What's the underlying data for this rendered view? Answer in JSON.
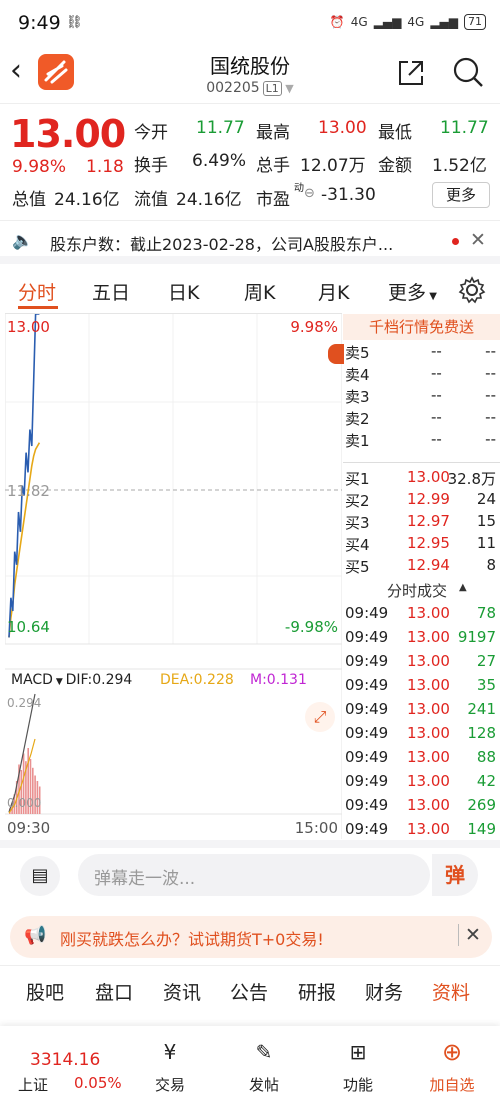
{
  "status": {
    "time": "9:49",
    "net1": "4G",
    "net2": "4G",
    "battery": "71"
  },
  "header": {
    "title": "国统股份",
    "code": "002205",
    "level": "L1"
  },
  "quote": {
    "price": "13.00",
    "change_pct": "9.98%",
    "change": "1.18",
    "open_label": "今开",
    "open": "11.77",
    "high_label": "最高",
    "high": "13.00",
    "low_label": "最低",
    "low": "11.77",
    "turnover_label": "换手",
    "turnover": "6.49%",
    "volume_label": "总手",
    "volume": "12.07万",
    "amount_label": "金额",
    "amount": "1.52亿",
    "total_cap_label": "总值",
    "total_cap": "24.16亿",
    "float_cap_label": "流值",
    "float_cap": "24.16亿",
    "pe_label": "市盈",
    "pe_sup": "动",
    "pe": "-31.30",
    "more": "更多"
  },
  "notice": {
    "text": "股东户数：截止2023-02-28，公司A股股东户..."
  },
  "tabs": [
    "分时",
    "五日",
    "日K",
    "周K",
    "月K",
    "更多"
  ],
  "chart": {
    "top_price": "13.00",
    "top_pct": "9.98%",
    "mid_price": "11.82",
    "bottom_price": "10.64",
    "bottom_pct": "-9.98%",
    "macd_label": "MACD",
    "dif": "DIF:0.294",
    "dea": "DEA:0.228",
    "m": "M:0.131",
    "macd_top": "0.294",
    "macd_zero": "0.000",
    "time_start": "09:30",
    "time_end": "15:00",
    "price_line": [
      0.98,
      0.86,
      0.9,
      0.72,
      0.76,
      0.6,
      0.66,
      0.52,
      0.55,
      0.42,
      0.48,
      0.35,
      0.4,
      0.2,
      0.0,
      0.0,
      0.0
    ],
    "avg_line": [
      0.98,
      0.92,
      0.88,
      0.82,
      0.78,
      0.74,
      0.7,
      0.66,
      0.62,
      0.58,
      0.54,
      0.5,
      0.46,
      0.43,
      0.41,
      0.4,
      0.39
    ],
    "macd_bars": [
      0.05,
      0.1,
      0.18,
      0.3,
      0.45,
      0.4,
      0.55,
      0.48,
      0.6,
      0.5,
      0.42,
      0.35,
      0.3,
      0.25
    ]
  },
  "orderbook": {
    "promo": "千档行情免费送",
    "asks": [
      {
        "label": "卖5",
        "price": "--",
        "vol": "--"
      },
      {
        "label": "卖4",
        "price": "--",
        "vol": "--"
      },
      {
        "label": "卖3",
        "price": "--",
        "vol": "--"
      },
      {
        "label": "卖2",
        "price": "--",
        "vol": "--"
      },
      {
        "label": "卖1",
        "price": "--",
        "vol": "--"
      }
    ],
    "bids": [
      {
        "label": "买1",
        "price": "13.00",
        "vol": "32.8万"
      },
      {
        "label": "买2",
        "price": "12.99",
        "vol": "24"
      },
      {
        "label": "买3",
        "price": "12.97",
        "vol": "15"
      },
      {
        "label": "买4",
        "price": "12.95",
        "vol": "11"
      },
      {
        "label": "买5",
        "price": "12.94",
        "vol": "8"
      }
    ],
    "trades_title": "分时成交",
    "trades": [
      {
        "time": "09:49",
        "price": "13.00",
        "vol": "78"
      },
      {
        "time": "09:49",
        "price": "13.00",
        "vol": "9197"
      },
      {
        "time": "09:49",
        "price": "13.00",
        "vol": "27"
      },
      {
        "time": "09:49",
        "price": "13.00",
        "vol": "35"
      },
      {
        "time": "09:49",
        "price": "13.00",
        "vol": "241"
      },
      {
        "time": "09:49",
        "price": "13.00",
        "vol": "128"
      },
      {
        "time": "09:49",
        "price": "13.00",
        "vol": "88"
      },
      {
        "time": "09:49",
        "price": "13.00",
        "vol": "42"
      },
      {
        "time": "09:49",
        "price": "13.00",
        "vol": "269"
      },
      {
        "time": "09:49",
        "price": "13.00",
        "vol": "149"
      }
    ]
  },
  "barrage": {
    "placeholder": "弹幕走一波...",
    "btn": "弹"
  },
  "ad": {
    "text": "刚买就跌怎么办？试试期货T+0交易!"
  },
  "bottom_tabs": [
    "股吧",
    "盘口",
    "资讯",
    "公告",
    "研报",
    "财务",
    "资料"
  ],
  "dock": {
    "index_value": "3314.16",
    "index_name": "上证",
    "index_change": "0.05%",
    "items": [
      "交易",
      "发帖",
      "功能",
      "加自选"
    ]
  }
}
